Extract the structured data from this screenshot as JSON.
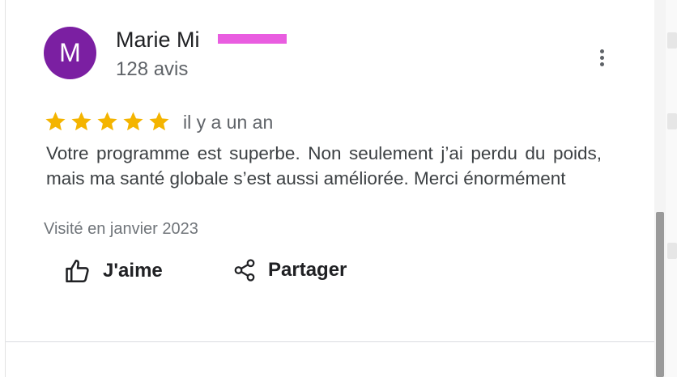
{
  "review": {
    "author": {
      "avatar_initial": "M",
      "avatar_color": "#7b1fa2",
      "name": "Marie Mi",
      "name_redacted": true,
      "review_count": "128 avis"
    },
    "rating": 5,
    "rating_max": 5,
    "star_color": "#f4b400",
    "relative_time": "il y a un an",
    "text": "Votre programme est superbe. Non seulement j’ai perdu du poids, mais ma santé globale s’est aussi améliorée. Merci énormément",
    "visited": "Visité en janvier 2023",
    "actions": {
      "like_label": "J'aime",
      "share_label": "Partager"
    },
    "more_options_icon": "more-vert-icon"
  }
}
